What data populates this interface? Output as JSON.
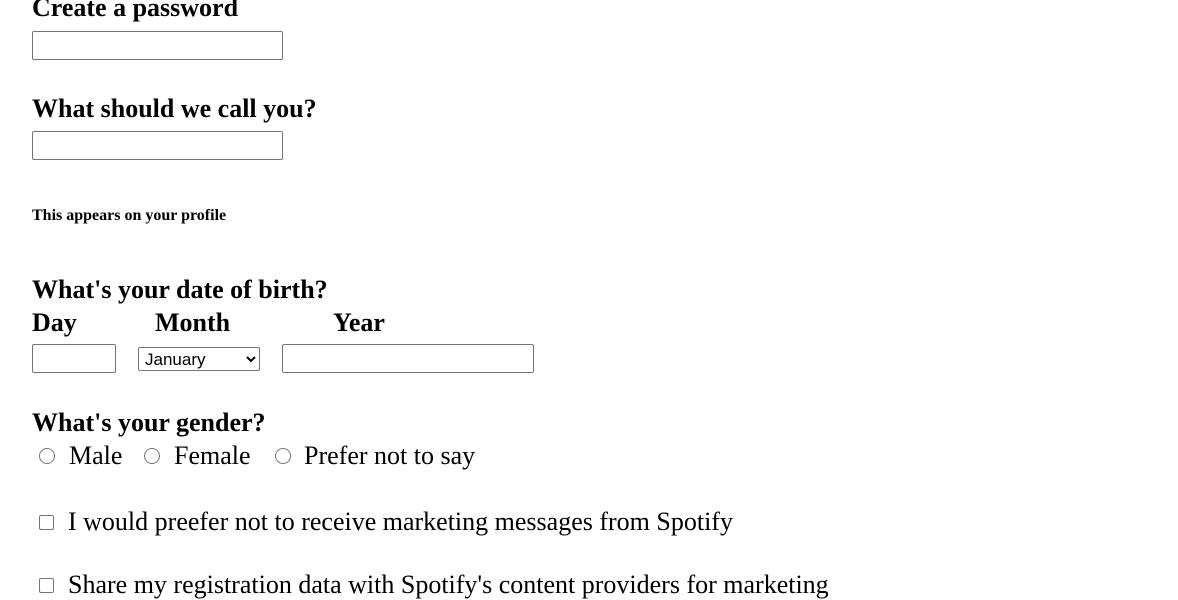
{
  "password": {
    "label": "Create a password",
    "value": ""
  },
  "name": {
    "label": "What should we call you?",
    "value": "",
    "hint": "This appears on your profile"
  },
  "dob": {
    "label": "What's your date of birth?",
    "day_label": "Day",
    "month_label": "Month",
    "year_label": "Year",
    "day_value": "",
    "month_selected": "January",
    "year_value": ""
  },
  "gender": {
    "label": "What's your gender?",
    "options": [
      "Male",
      "Female",
      "Prefer not to say"
    ]
  },
  "consents": [
    {
      "label": "I would preefer not to receive marketing messages from Spotify",
      "checked": false
    },
    {
      "label": "Share my registration data with Spotify's content providers for marketing",
      "checked": false
    }
  ]
}
